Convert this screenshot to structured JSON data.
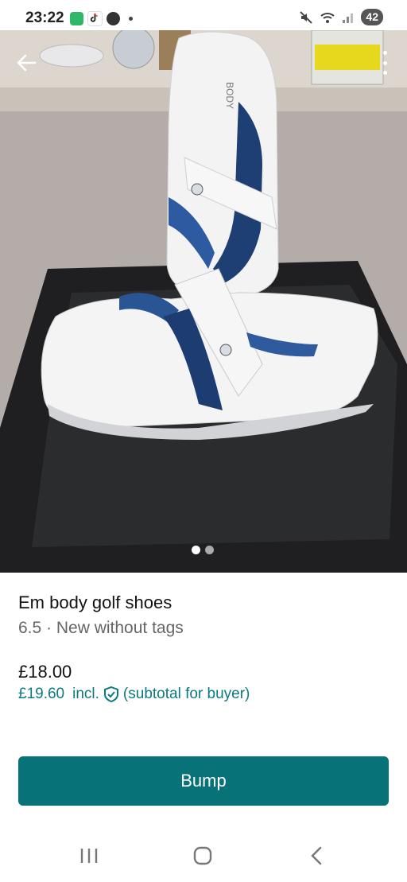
{
  "status": {
    "time": "23:22",
    "battery": "42"
  },
  "listing": {
    "title": "Em body golf shoes",
    "details": "6.5 · New without tags",
    "price": "£18.00",
    "buyer_price": "£19.60",
    "incl_label": "incl.",
    "buyer_note": "(subtotal for buyer)"
  },
  "gallery": {
    "page_count": 2,
    "active_index": 0
  },
  "actions": {
    "bump_label": "Bump"
  },
  "icons": {
    "back": "arrow-left-icon",
    "more": "more-vertical-icon",
    "shield": "shield-check-icon",
    "recents": "recents-icon",
    "home": "home-icon",
    "nav_back": "nav-back-icon"
  },
  "colors": {
    "accent": "#087279",
    "link": "#0a7a80"
  }
}
